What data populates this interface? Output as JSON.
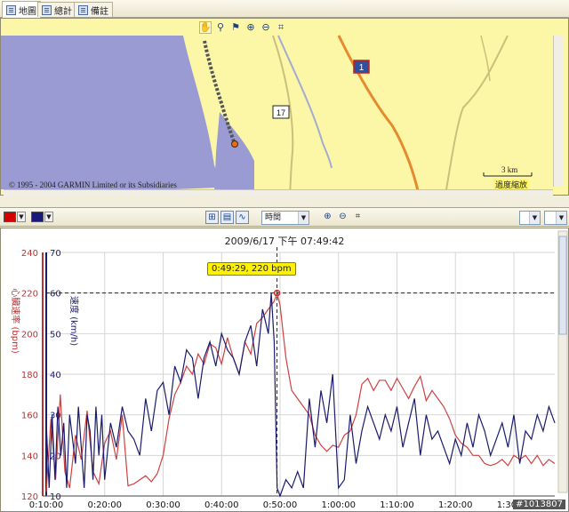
{
  "tabs": [
    {
      "label": "地圖",
      "active": true
    },
    {
      "label": "總計",
      "active": false
    },
    {
      "label": "備註",
      "active": false
    }
  ],
  "map": {
    "copyright": "© 1995 - 2004 GARMIN Limited or its Subsidiaries",
    "scale_label": "3 km",
    "zoom_note": "過度縮放",
    "route_shields": [
      "1",
      "17"
    ]
  },
  "chart_toolbar": {
    "hr_color": "#d40000",
    "speed_color": "#1a1a7a",
    "axis_select": "時間"
  },
  "chart": {
    "timestamp": "2009/6/17 下午 07:49:42",
    "callout": "0:49:29, 220 bpm"
  },
  "watermark": "#1013807",
  "chart_data": {
    "type": "line",
    "xlabel": "",
    "x_ticks": [
      "0:10:00",
      "0:20:00",
      "0:30:00",
      "0:40:00",
      "0:50:00",
      "1:00:00",
      "1:10:00",
      "1:20:00",
      "1:30:00"
    ],
    "xlim": [
      "0:10:00",
      "1:37:00"
    ],
    "y_left": {
      "label": "心臟速率 (bpm)",
      "ticks": [
        120,
        140,
        160,
        180,
        200,
        220,
        240
      ],
      "range": [
        120,
        240
      ]
    },
    "y_right": {
      "label": "速度 (km/h)",
      "ticks": [
        10,
        20,
        30,
        40,
        50,
        60,
        70
      ],
      "range": [
        10,
        70
      ]
    },
    "crosshair": {
      "x": "0:49:29",
      "y": 220
    },
    "series": [
      {
        "name": "心臟速率 (bpm)",
        "color": "#d04040",
        "axis": "left",
        "x": [
          10.0,
          10.8,
          11.6,
          12.4,
          13.2,
          14.0,
          15.0,
          16.0,
          17.0,
          18.0,
          19.0,
          20.0,
          21.0,
          22.0,
          23.0,
          24.0,
          25.0,
          26.0,
          27.0,
          28.0,
          29.0,
          30.0,
          31.0,
          32.0,
          33.0,
          34.0,
          35.0,
          36.0,
          37.0,
          38.0,
          39.0,
          40.0,
          41.0,
          42.0,
          43.0,
          44.0,
          45.0,
          46.0,
          47.0,
          48.0,
          49.0,
          49.5,
          50.0,
          51.0,
          52.0,
          53.0,
          54.0,
          55.0,
          56.0,
          57.0,
          58.0,
          59.0,
          60.0,
          61.0,
          62.0,
          63.0,
          64.0,
          65.0,
          66.0,
          67.0,
          68.0,
          69.0,
          70.0,
          71.0,
          72.0,
          73.0,
          74.0,
          75.0,
          76.0,
          77.0,
          78.0,
          79.0,
          80.0,
          81.0,
          82.0,
          83.0,
          84.0,
          85.0,
          86.0,
          87.0,
          88.0,
          89.0,
          90.0,
          91.0,
          92.0,
          93.0,
          94.0,
          95.0,
          96.0,
          97.0
        ],
        "y": [
          122,
          158,
          128,
          170,
          132,
          124,
          150,
          138,
          162,
          132,
          126,
          146,
          152,
          138,
          160,
          125,
          126,
          128,
          130,
          127,
          131,
          140,
          158,
          170,
          176,
          184,
          180,
          190,
          185,
          195,
          193,
          185,
          198,
          188,
          180,
          196,
          190,
          205,
          208,
          212,
          216,
          220,
          214,
          188,
          172,
          168,
          164,
          160,
          150,
          145,
          142,
          145,
          144,
          150,
          152,
          160,
          175,
          178,
          172,
          177,
          177,
          172,
          178,
          173,
          168,
          174,
          179,
          167,
          172,
          168,
          164,
          158,
          150,
          146,
          144,
          140,
          140,
          136,
          135,
          136,
          138,
          135,
          140,
          138,
          140,
          136,
          140,
          135,
          138,
          136
        ]
      },
      {
        "name": "速度 (km/h)",
        "color": "#1a1a6e",
        "axis": "right",
        "x": [
          10.0,
          10.5,
          11.0,
          11.5,
          12.0,
          12.5,
          13.0,
          13.5,
          14.0,
          14.5,
          15.0,
          15.5,
          16.0,
          16.5,
          17.0,
          17.5,
          18.0,
          18.5,
          19.0,
          19.5,
          20.0,
          21.0,
          22.0,
          23.0,
          24.0,
          25.0,
          26.0,
          27.0,
          28.0,
          29.0,
          30.0,
          31.0,
          32.0,
          33.0,
          34.0,
          35.0,
          36.0,
          37.0,
          38.0,
          39.0,
          40.0,
          41.0,
          42.0,
          43.0,
          44.0,
          45.0,
          46.0,
          47.0,
          48.0,
          48.5,
          49.0,
          49.5,
          50.0,
          51.0,
          52.0,
          53.0,
          54.0,
          55.0,
          56.0,
          57.0,
          58.0,
          59.0,
          60.0,
          61.0,
          62.0,
          63.0,
          64.0,
          65.0,
          66.0,
          67.0,
          68.0,
          69.0,
          70.0,
          71.0,
          72.0,
          73.0,
          74.0,
          75.0,
          76.0,
          77.0,
          78.0,
          79.0,
          80.0,
          81.0,
          82.0,
          83.0,
          84.0,
          85.0,
          86.0,
          87.0,
          88.0,
          89.0,
          90.0,
          91.0,
          92.0,
          93.0,
          94.0,
          95.0,
          96.0,
          97.0
        ],
        "y": [
          28,
          12,
          30,
          14,
          32,
          20,
          28,
          12,
          30,
          24,
          18,
          32,
          22,
          12,
          30,
          26,
          14,
          32,
          20,
          30,
          14,
          28,
          22,
          32,
          26,
          24,
          20,
          34,
          26,
          36,
          38,
          30,
          42,
          38,
          46,
          44,
          34,
          44,
          48,
          42,
          50,
          46,
          44,
          40,
          48,
          52,
          42,
          56,
          50,
          60,
          48,
          12,
          10,
          14,
          12,
          16,
          12,
          34,
          22,
          36,
          28,
          40,
          12,
          14,
          30,
          18,
          26,
          32,
          28,
          24,
          30,
          26,
          32,
          22,
          28,
          34,
          20,
          30,
          24,
          26,
          22,
          18,
          24,
          20,
          28,
          22,
          30,
          26,
          20,
          24,
          28,
          22,
          30,
          18,
          26,
          24,
          30,
          26,
          32,
          28
        ]
      }
    ]
  }
}
